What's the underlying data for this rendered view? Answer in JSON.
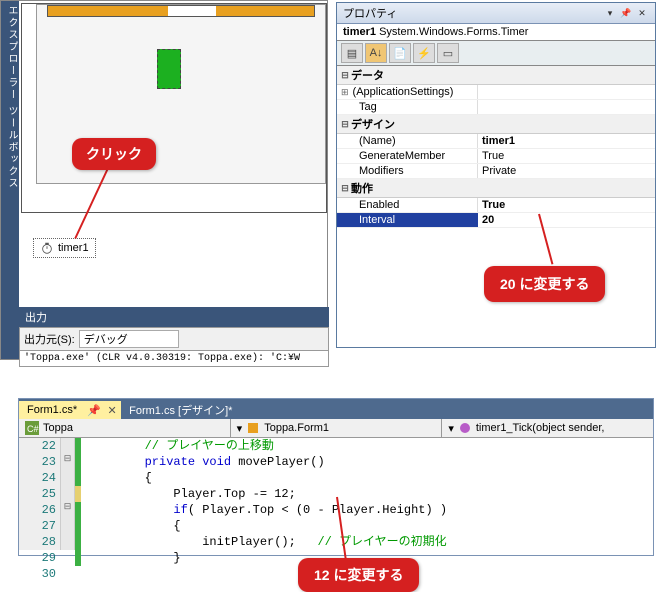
{
  "sidebar_label": "エクスプローラー ツールボックス",
  "tray_timer": "timer1",
  "click_label": "クリック",
  "output": {
    "title": "出力",
    "src_label": "出力元(S):",
    "src_value": "デバッグ",
    "log": "'Toppa.exe' (CLR v4.0.30319: Toppa.exe): 'C:¥W"
  },
  "props": {
    "title": "プロパティ",
    "object_name": "timer1",
    "object_type": "System.Windows.Forms.Timer",
    "cat_data": "データ",
    "row_appsettings": "(ApplicationSettings)",
    "row_tag": "Tag",
    "cat_design": "デザイン",
    "row_name": "(Name)",
    "val_name": "timer1",
    "row_genmember": "GenerateMember",
    "val_genmember": "True",
    "row_modifiers": "Modifiers",
    "val_modifiers": "Private",
    "cat_behavior": "動作",
    "row_enabled": "Enabled",
    "val_enabled": "True",
    "row_interval": "Interval",
    "val_interval": "20"
  },
  "callout20": "20 に変更する",
  "callout12": "12 に変更する",
  "code": {
    "tab_active": "Form1.cs*",
    "tab_design": "Form1.cs [デザイン]*",
    "nav_ns": "Toppa",
    "nav_class": "Toppa.Form1",
    "nav_method": "timer1_Tick(object sender,",
    "lines": {
      "n22": "22",
      "n23": "23",
      "n24": "24",
      "n25": "25",
      "n26": "26",
      "n27": "27",
      "n28": "28",
      "n29": "29",
      "n30": "30"
    },
    "l22": "        // プレイヤーの上移動",
    "l23_a": "        private",
    "l23_b": " void",
    "l23_c": " movePlayer()",
    "l24": "        {",
    "l25": "            Player.Top -= 12;",
    "l26_a": "            if",
    "l26_b": "( Player.Top < (0 - Player.Height) )",
    "l27": "            {",
    "l28_a": "                initPlayer();   ",
    "l28_b": "// プレイヤーの初期化",
    "l29": "            }"
  }
}
